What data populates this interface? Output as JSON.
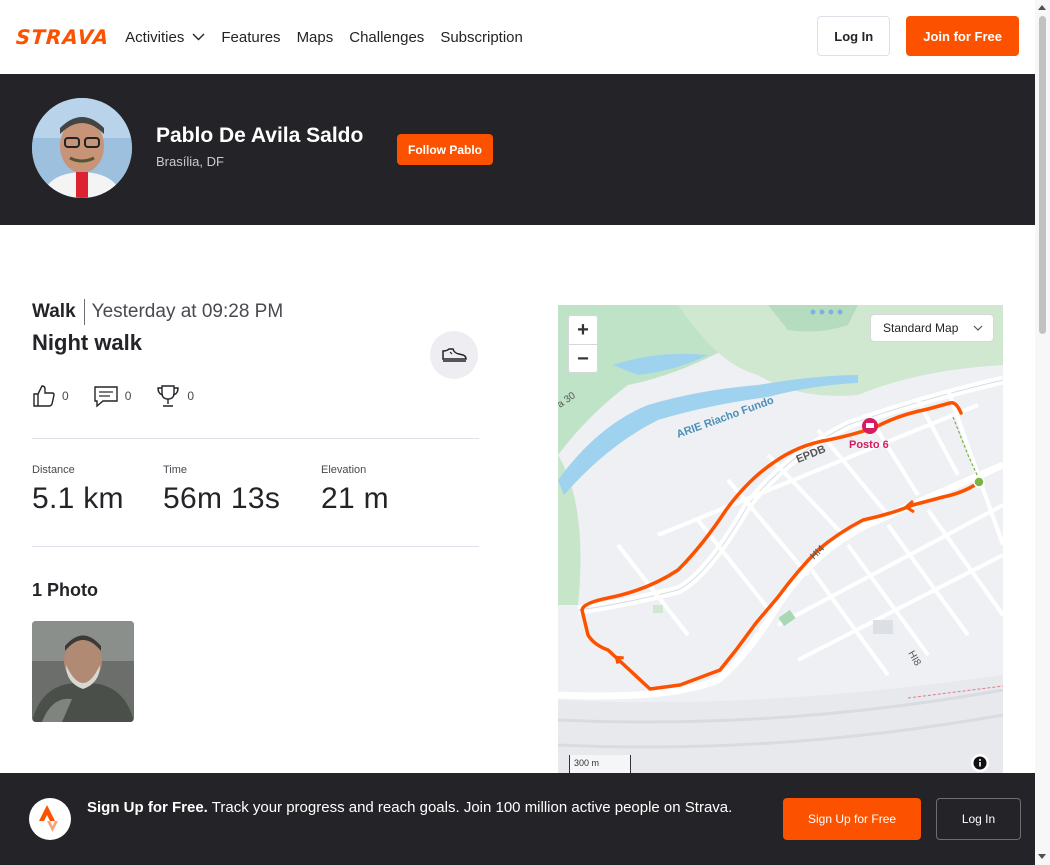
{
  "nav": {
    "logo": "STRAVA",
    "links": [
      "Activities",
      "Features",
      "Maps",
      "Challenges",
      "Subscription"
    ],
    "login_label": "Log In",
    "join_label": "Join for Free"
  },
  "athlete": {
    "name": "Pablo De Avila Saldo",
    "location": "Brasília, DF",
    "follow_label": "Follow Pablo"
  },
  "activity": {
    "type": "Walk",
    "date": "Yesterday at 09:28 PM",
    "name": "Night walk",
    "kudos_count": "0",
    "comments_count": "0",
    "achievements_count": "0",
    "stats": [
      {
        "label": "Distance",
        "value": "5.1 km"
      },
      {
        "label": "Time",
        "value": "56m 13s"
      },
      {
        "label": "Elevation",
        "value": "21 m"
      }
    ],
    "photos_title": "1 Photo"
  },
  "map": {
    "style_label": "Standard Map",
    "scale_label": "300 m",
    "labels": {
      "water": "ARIE Riacho Fundo",
      "road_epdb": "EPDB",
      "road_hi4": "HI4",
      "road_hi8": "HI8",
      "road_a30": "a 30",
      "poi": "Posto 6"
    },
    "route_color": "#fc5200",
    "start_color": "#7cb342"
  },
  "banner": {
    "headline": "Sign Up for Free.",
    "body": "Track your progress and reach goals. Join 100 million active people on Strava.",
    "signup_label": "Sign Up for Free",
    "login_label": "Log In"
  },
  "colors": {
    "brand": "#fc5200",
    "dark": "#242428"
  }
}
